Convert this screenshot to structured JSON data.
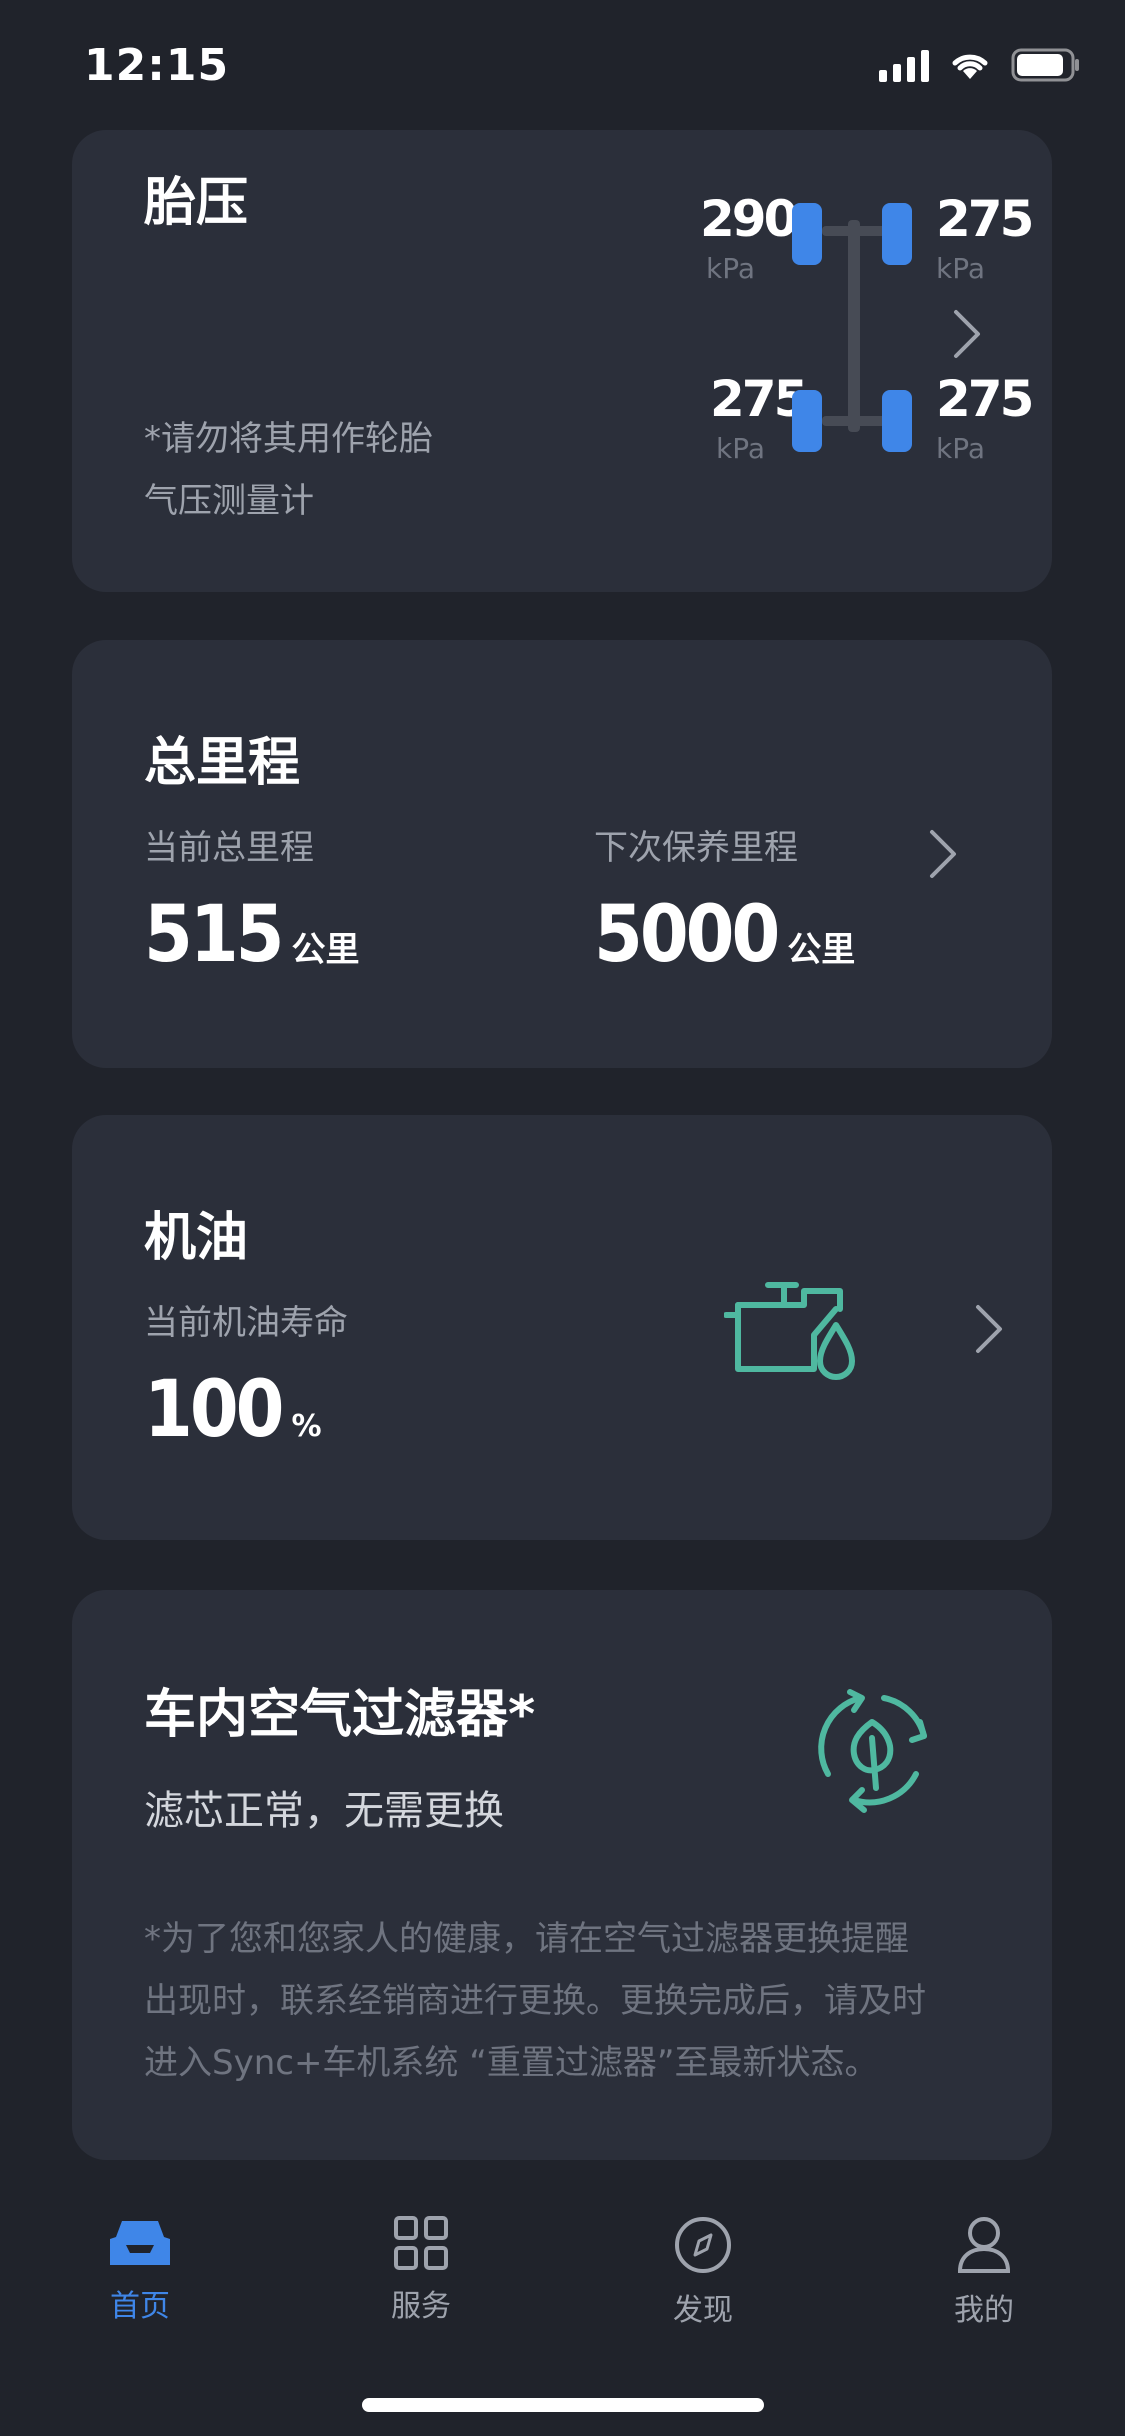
{
  "status_bar": {
    "time": "12:15"
  },
  "tire_pressure": {
    "title": "胎压",
    "note_line1": "*请勿将其用作轮胎",
    "note_line2": "气压测量计",
    "front_left": "290",
    "front_right": "275",
    "rear_left": "275",
    "rear_right": "275",
    "unit": "kPa"
  },
  "mileage": {
    "title": "总里程",
    "current_label": "当前总里程",
    "current_value": "515",
    "current_unit": "公里",
    "next_label": "下次保养里程",
    "next_value": "5000",
    "next_unit": "公里"
  },
  "oil": {
    "title": "机油",
    "label": "当前机油寿命",
    "value": "100",
    "unit": "%"
  },
  "air_filter": {
    "title": "车内空气过滤器*",
    "status": "滤芯正常，无需更换",
    "note_line1": "*为了您和您家人的健康，请在空气过滤器更换提醒",
    "note_line2": "出现时，联系经销商进行更换。更换完成后，请及时",
    "note_line3": "进入Sync+车机系统 “重置过滤器”至最新状态。"
  },
  "tabs": [
    {
      "label": "首页",
      "icon": "car-icon",
      "active": true
    },
    {
      "label": "服务",
      "icon": "grid-icon",
      "active": false
    },
    {
      "label": "发现",
      "icon": "compass-icon",
      "active": false
    },
    {
      "label": "我的",
      "icon": "profile-icon",
      "active": false
    }
  ],
  "colors": {
    "background": "#20232b",
    "card": "#2b2f3a",
    "accent_blue": "#3f86e8",
    "accent_teal": "#4fb8a0",
    "muted_text": "#9ea3ad"
  }
}
